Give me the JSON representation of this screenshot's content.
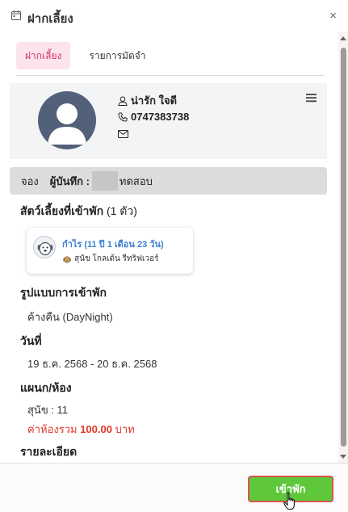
{
  "header": {
    "title": "ฝากเลี้ยง",
    "calendar_icon": "calendar-icon",
    "close_icon": "close-icon",
    "close_glyph": "×"
  },
  "tabs": [
    {
      "label": "ฝากเลี้ยง",
      "active": true
    },
    {
      "label": "รายการมัดจำ",
      "active": false
    }
  ],
  "profile": {
    "name": "น่ารัก ใจดี",
    "phone": "0747383738",
    "icons": [
      "user-icon",
      "phone-icon",
      "mail-icon",
      "menu-icon"
    ]
  },
  "booking_bar": {
    "label1": "จอง",
    "label2": "ผู้บันทึก :",
    "recorder": "ทดสอบ"
  },
  "pets_section": {
    "title": "สัตว์เลี้ยงที่เข้าพัก",
    "count": "(1 ตัว)",
    "pets": [
      {
        "name": "กำไร (11 ปี 1 เดือน 23 วัน)",
        "breed": "สุนัข โกลเด้น รีทริฟเวอร์"
      }
    ]
  },
  "stay_type": {
    "title": "รูปแบบการเข้าพัก",
    "value": "ค้างคืน (DayNight)"
  },
  "dates": {
    "title": "วันที่",
    "value": "19 ธ.ค. 2568 - 20 ธ.ค. 2568"
  },
  "room": {
    "title": "แผนก/ห้อง",
    "value": "สุนัข : 11",
    "price_label": "ค่าห้องรวม",
    "price_amount": "100.00",
    "price_unit": "บาท"
  },
  "details": {
    "title": "รายละเอียด"
  },
  "footer": {
    "checkin_label": "เข้าพัก"
  },
  "colors": {
    "accent_pink": "#d6336c",
    "tab_active_bg": "#fde4ec",
    "pet_name": "#3a7fd1",
    "price_red": "#e0352b",
    "button_green": "#5ec83a",
    "button_border": "#d9534f"
  }
}
